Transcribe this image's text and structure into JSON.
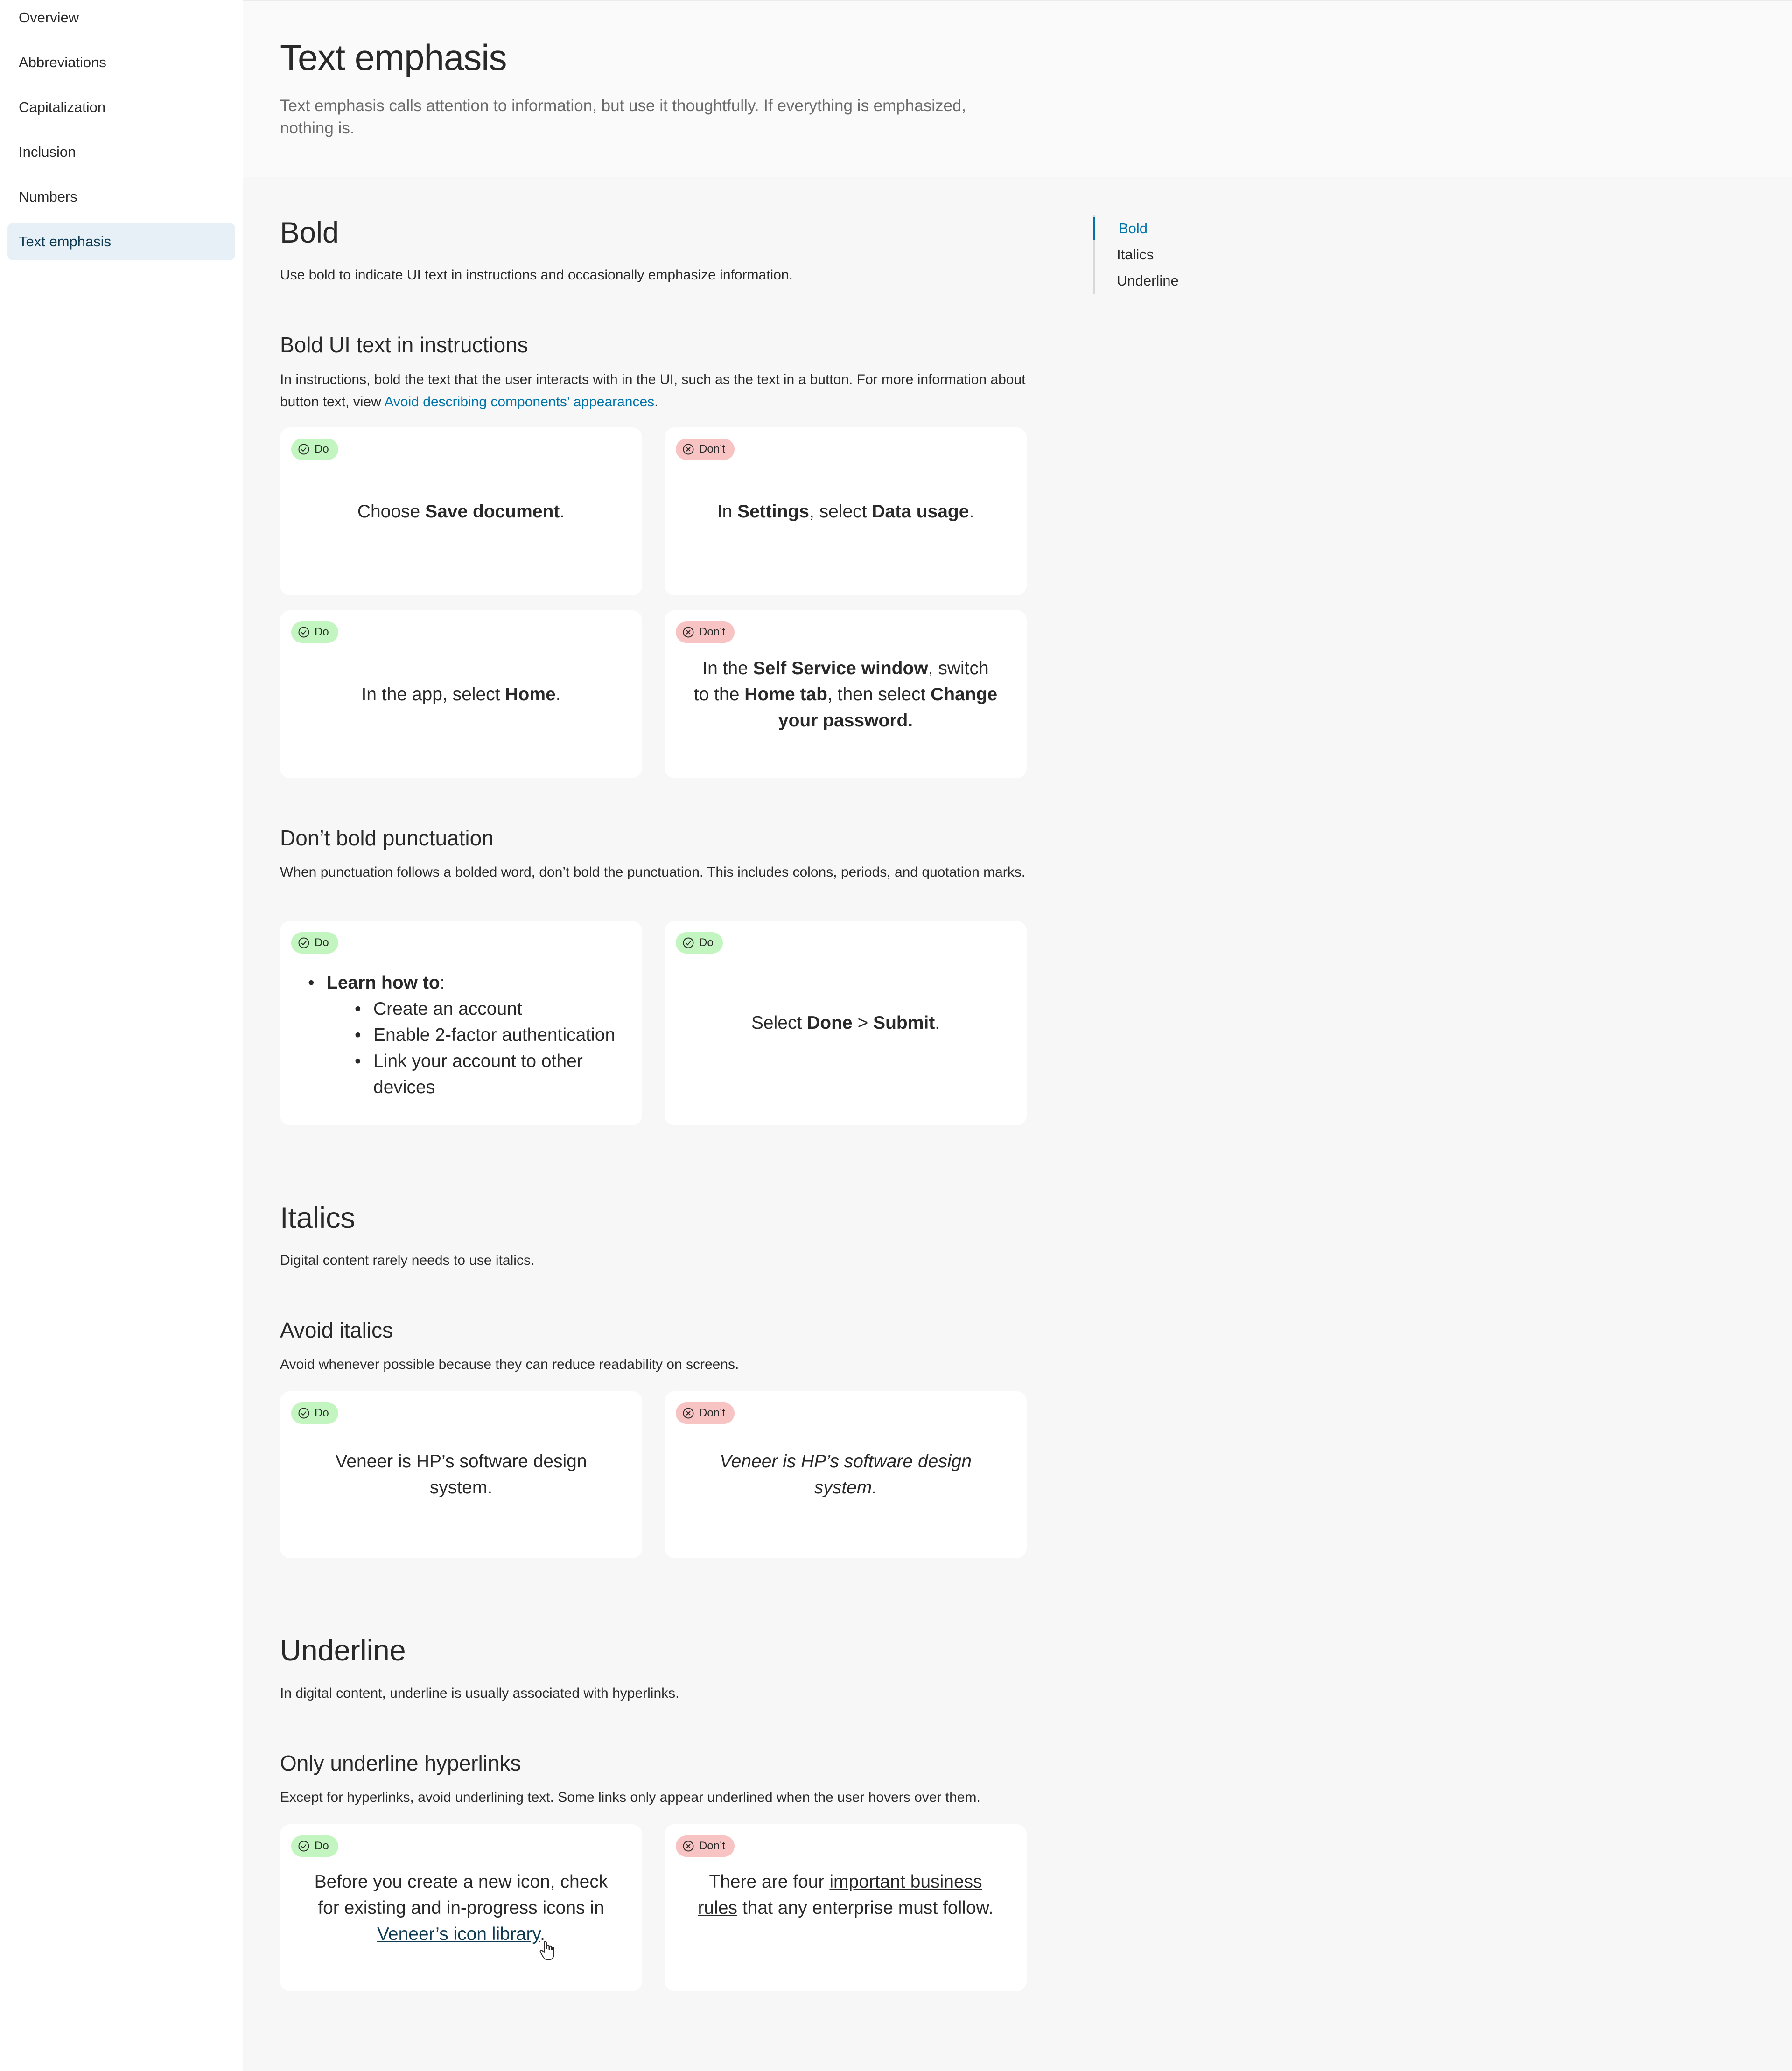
{
  "sidebar": {
    "items": [
      {
        "label": "Overview"
      },
      {
        "label": "Abbreviations"
      },
      {
        "label": "Capitalization"
      },
      {
        "label": "Inclusion"
      },
      {
        "label": "Numbers"
      },
      {
        "label": "Text emphasis",
        "active": true
      }
    ]
  },
  "header": {
    "title": "Text emphasis",
    "intro": "Text emphasis calls attention to information, but use it thoughtfully. If everything is emphasized, nothing is."
  },
  "toc": {
    "items": [
      {
        "label": "Bold",
        "active": true
      },
      {
        "label": "Italics"
      },
      {
        "label": "Underline"
      }
    ]
  },
  "badges": {
    "do": "Do",
    "dont": "Don’t"
  },
  "colors": {
    "link": "#0073a8",
    "do_badge": "#c2f5c0",
    "dont_badge": "#f8c3c3",
    "active_nav": "#e6f0f6"
  },
  "bold": {
    "heading": "Bold",
    "description": "Use bold to indicate UI text in instructions and occasionally emphasize information.",
    "sub1": {
      "heading": "Bold UI text in instructions",
      "text_pre": "In instructions, bold the text that the user interacts with in the UI, such as the text in a button. For more information about button text, view ",
      "link": "Avoid describing components’ appearances",
      "text_post": ".",
      "ex1_do": {
        "pre": "Choose ",
        "b": "Save document",
        "post": "."
      },
      "ex2_dont": {
        "pre": "In ",
        "b1": "Settings",
        "mid": ", select ",
        "b2": "Data usage",
        "post": "."
      },
      "ex3_do": {
        "pre": "In the app, select ",
        "b": "Home",
        "post": "."
      },
      "ex4_dont": {
        "pre": "In the ",
        "b1": "Self Service window",
        "mid1": ", switch to the ",
        "b2": "Home tab",
        "mid2": ", then select ",
        "b3": "Change your password."
      }
    },
    "sub2": {
      "heading": "Don’t bold punctuation",
      "text": "When punctuation follows a bolded word, don’t bold the punctuation. This includes colons, periods, and quotation marks.",
      "ex1_do": {
        "lead_b": "Learn how to",
        "lead_post": ":",
        "items": [
          "Create an account",
          "Enable 2-factor authentication",
          "Link your account to other devices"
        ]
      },
      "ex2_do": {
        "pre": "Select ",
        "b1": "Done",
        "mid": " > ",
        "b2": "Submit",
        "post": "."
      }
    }
  },
  "italics": {
    "heading": "Italics",
    "description": "Digital content rarely needs to use italics.",
    "sub1": {
      "heading": "Avoid italics",
      "text": "Avoid whenever possible because they can reduce readability on screens.",
      "ex_do": "Veneer is HP’s software design system.",
      "ex_dont": "Veneer is HP’s software design system."
    }
  },
  "underline": {
    "heading": "Underline",
    "description": "In digital content, underline is usually associated with hyperlinks.",
    "sub1": {
      "heading": "Only underline hyperlinks",
      "text": "Except for hyperlinks, avoid underlining text. Some links only appear underlined when the user hovers over them.",
      "ex_do": {
        "pre": "Before you create a new icon, check for existing and in-progress icons in ",
        "link": "Veneer’s icon library",
        "post": "."
      },
      "ex_dont": {
        "pre": "There are four ",
        "u": "important business rules",
        "post": " that any enterprise must follow."
      }
    }
  }
}
